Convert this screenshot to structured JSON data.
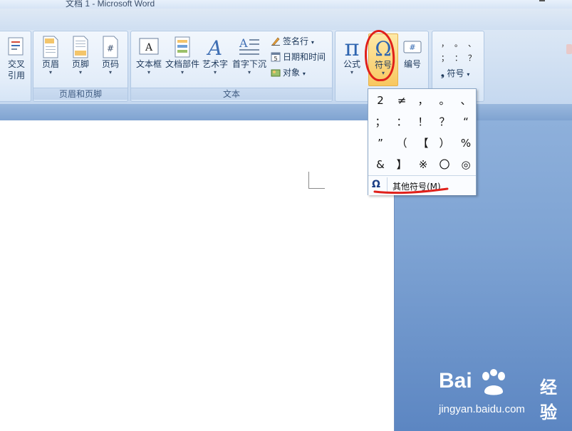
{
  "window": {
    "title": "文档 1 - Microsoft Word"
  },
  "ribbon": {
    "groups": {
      "references": {
        "cross_ref_line1": "交叉",
        "cross_ref_line2": "引用"
      },
      "header_footer": {
        "label": "页眉和页脚",
        "header": "页眉",
        "footer": "页脚",
        "page_number": "页码"
      },
      "text": {
        "label": "文本",
        "text_box": "文本框",
        "quick_parts": "文档部件",
        "wordart": "艺术字",
        "drop_cap": "首字下沉",
        "signature_line": "签名行",
        "date_time": "日期和时间",
        "object": "对象"
      },
      "symbols": {
        "equation": "公式",
        "symbol": "符号",
        "number": "编号"
      },
      "special_symbols": {
        "symbol": "符号",
        "preview": [
          "，",
          "。",
          "、",
          "；",
          "：",
          "？"
        ]
      }
    },
    "caret": "▾"
  },
  "symbol_dropdown": {
    "symbols": [
      "2",
      "≠",
      "，",
      "。",
      "、",
      "；",
      "：",
      "！",
      "？",
      "“",
      "”",
      "（",
      "【",
      "）",
      "%",
      "&",
      "】",
      "※",
      "〇",
      "◎"
    ],
    "more_symbols_icon": "Ω",
    "more_symbols": "其他符号(M)..."
  },
  "icons": {
    "cross_reference": "cross-reference-icon",
    "header": "page-header-icon",
    "footer": "page-footer-icon",
    "page_number": "page-number-icon",
    "text_box": "text-box-icon",
    "quick_parts": "quick-parts-icon",
    "wordart": "wordart-icon",
    "drop_cap": "drop-cap-icon",
    "equation": "pi-icon",
    "symbol": "omega-icon",
    "number": "number-icon"
  },
  "watermark": {
    "brand_left": "Bai",
    "brand_right": "du",
    "brand_cn": "经验",
    "url": "jingyan.baidu.com"
  },
  "colors": {
    "annotation_red": "#e0201a",
    "ribbon_text": "#1e395b",
    "document_background": "#7ea3d3"
  }
}
